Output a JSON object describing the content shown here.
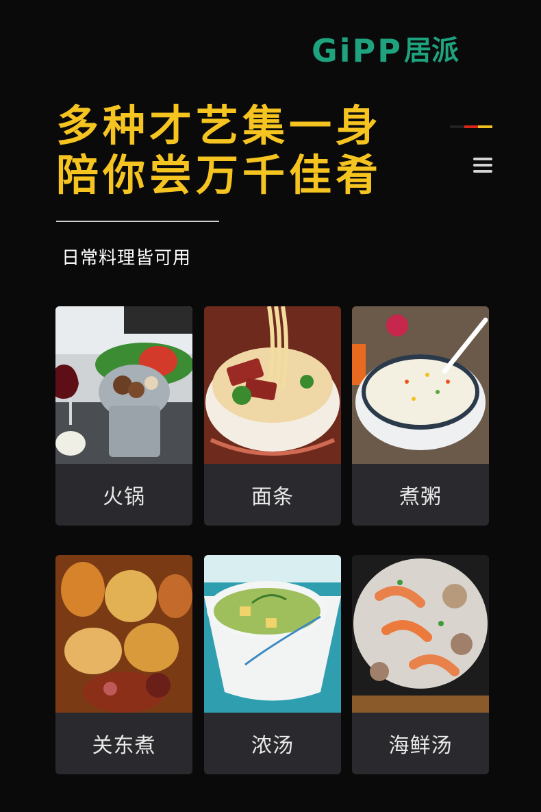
{
  "brand": {
    "latin": "GiPP",
    "chinese": "居派"
  },
  "headline": {
    "line1": "多种才艺集一身",
    "line2": "陪你尝万千佳肴"
  },
  "subtitle": "日常料理皆可用",
  "colors": {
    "accent": "#f6c421",
    "brand": "#1fa37f",
    "card": "#2a2a2e",
    "flag": [
      "#222222",
      "#d9261c",
      "#f2c01e"
    ]
  },
  "icons": {
    "menu": "menu-icon"
  },
  "dishes": [
    {
      "label": "火锅"
    },
    {
      "label": "面条"
    },
    {
      "label": "煮粥"
    },
    {
      "label": "关东煮"
    },
    {
      "label": "浓汤"
    },
    {
      "label": "海鲜汤"
    }
  ]
}
